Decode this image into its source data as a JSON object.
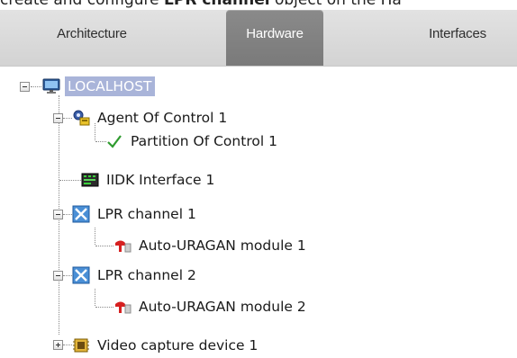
{
  "caption": {
    "prefix": "create and configure ",
    "bold": "LPR channel",
    "suffix": " object on the Ha"
  },
  "tabs": [
    {
      "label": "Architecture",
      "active": false
    },
    {
      "label": "Hardware",
      "active": true
    },
    {
      "label": "Interfaces",
      "active": false
    }
  ],
  "tree": {
    "root": {
      "label": "LOCALHOST",
      "icon": "monitor-icon",
      "expanded": true,
      "selected": true
    },
    "items": [
      {
        "label": "Agent Of Control 1",
        "icon": "agent-gears-icon",
        "expanded": true
      },
      {
        "label": "Partition Of Control 1",
        "icon": "checkmark-icon"
      },
      {
        "label": "IIDK Interface 1",
        "icon": "iidk-board-icon"
      },
      {
        "label": "LPR channel 1",
        "icon": "lpr-channel-icon",
        "expanded": true
      },
      {
        "label": "Auto-URAGAN module 1",
        "icon": "uragan-module-icon"
      },
      {
        "label": "LPR channel 2",
        "icon": "lpr-channel-icon",
        "expanded": true
      },
      {
        "label": "Auto-URAGAN module 2",
        "icon": "uragan-module-icon"
      },
      {
        "label": "Video capture device 1",
        "icon": "video-capture-chip-icon",
        "expanded": false
      }
    ]
  }
}
